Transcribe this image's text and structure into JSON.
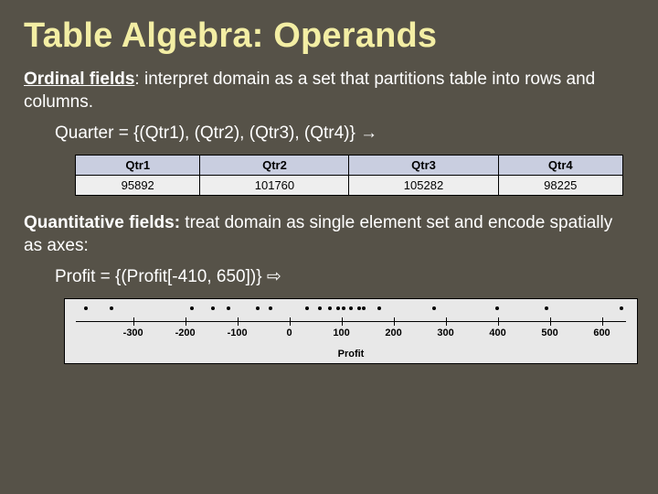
{
  "title": "Table Algebra: Operands",
  "ordinal": {
    "label": "Ordinal fields",
    "desc": ": interpret domain as a set that partitions table into rows and columns.",
    "example": "Quarter = {(Qtr1), (Qtr2), (Qtr3), (Qtr4)} →"
  },
  "quantitative": {
    "label": "Quantitative fields:",
    "desc": " treat domain as single element set and encode spatially as axes:",
    "example": "Profit = {(Profit[-410, 650])} ⇨"
  },
  "chart_data": [
    {
      "type": "table",
      "headers": [
        "Qtr1",
        "Qtr2",
        "Qtr3",
        "Qtr4"
      ],
      "rows": [
        [
          "95892",
          "101760",
          "105282",
          "98225"
        ]
      ]
    },
    {
      "type": "scatter",
      "title": "Profit",
      "xlabel": "Profit",
      "xlim": [
        -410,
        650
      ],
      "ticks": [
        -300,
        -200,
        -100,
        0,
        100,
        200,
        300,
        400,
        500,
        600
      ],
      "points_x": [
        -395,
        -345,
        -190,
        -150,
        -120,
        -65,
        -40,
        30,
        55,
        75,
        90,
        100,
        115,
        130,
        140,
        170,
        275,
        395,
        490,
        635
      ]
    }
  ]
}
